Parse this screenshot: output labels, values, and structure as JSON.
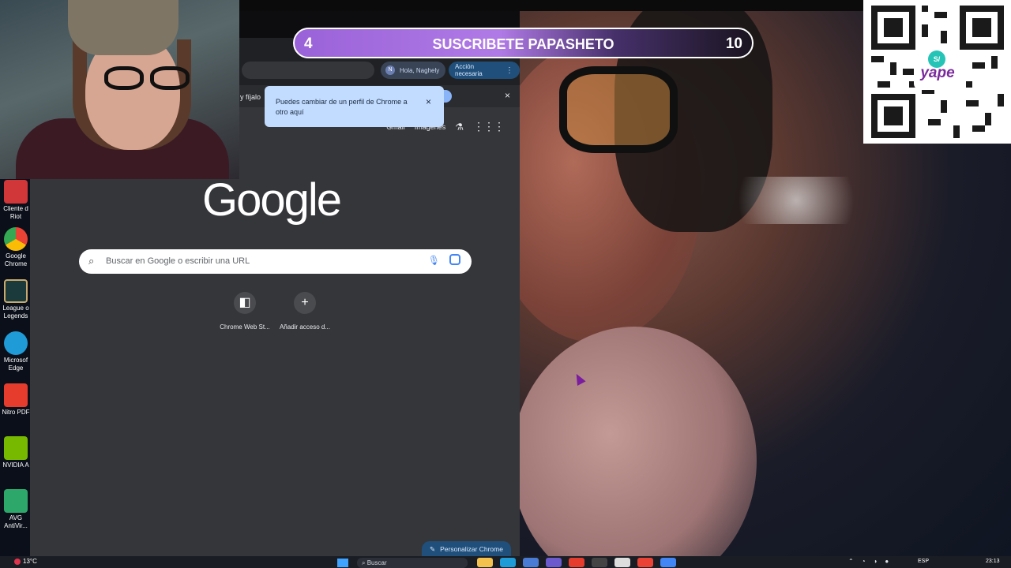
{
  "desktop": {
    "icons": [
      {
        "label_line1": "Cliente d",
        "label_line2": "Riot",
        "icon": "riot-client-icon",
        "color": "#d13639"
      },
      {
        "label_line1": "Google",
        "label_line2": "Chrome",
        "icon": "chrome-icon",
        "color": "#4285f4"
      },
      {
        "label_line1": "League o",
        "label_line2": "Legends",
        "icon": "league-of-legends-icon",
        "color": "#1b3a3c"
      },
      {
        "label_line1": "Microsof",
        "label_line2": "Edge",
        "icon": "edge-icon",
        "color": "#1f9bd7"
      },
      {
        "label_line1": "Nitro PDF",
        "label_line2": "",
        "icon": "nitro-pdf-icon",
        "color": "#e53c2e"
      },
      {
        "label_line1": "NVIDIA A",
        "label_line2": "",
        "icon": "nvidia-icon",
        "color": "#76b900"
      },
      {
        "label_line1": "AVG",
        "label_line2": "AntiVir...",
        "icon": "avg-antivirus-icon",
        "color": "#2ea76b"
      }
    ]
  },
  "chrome": {
    "profile_initial": "N",
    "profile_label": "Hola, Naghely",
    "action_label": "Acción necesaria",
    "action_menu": "⋮",
    "infobar_text": "y fíjalo",
    "infobar_close": "×",
    "gbar": {
      "gmail": "Gmail",
      "images": "Imágenes",
      "labs": "⚗",
      "apps": "⋮⋮⋮"
    },
    "logo": "Google",
    "search_placeholder": "Buscar en Google o escribir una URL",
    "shortcuts": [
      {
        "label": "Chrome Web St...",
        "glyph": "◧"
      },
      {
        "label": "Añadir acceso d...",
        "glyph": "+"
      }
    ],
    "customize_label": "Personalizar Chrome",
    "customize_glyph": "✎",
    "tooltip_text": "Puedes cambiar de un perfil de Chrome a otro aquí",
    "tooltip_close": "×"
  },
  "banner": {
    "left": "4",
    "text": "SUSCRIBETE PAPASHETO",
    "right": "10"
  },
  "qr": {
    "coin": "S/",
    "brand": "yape"
  },
  "taskbar": {
    "weather": "13°C",
    "search_label": "Buscar",
    "lang": "ESP",
    "clock": "23:13"
  },
  "colors": {
    "accent": "#9a62d8",
    "chrome_bg": "#35363a",
    "tooltip": "#c2dcff"
  }
}
